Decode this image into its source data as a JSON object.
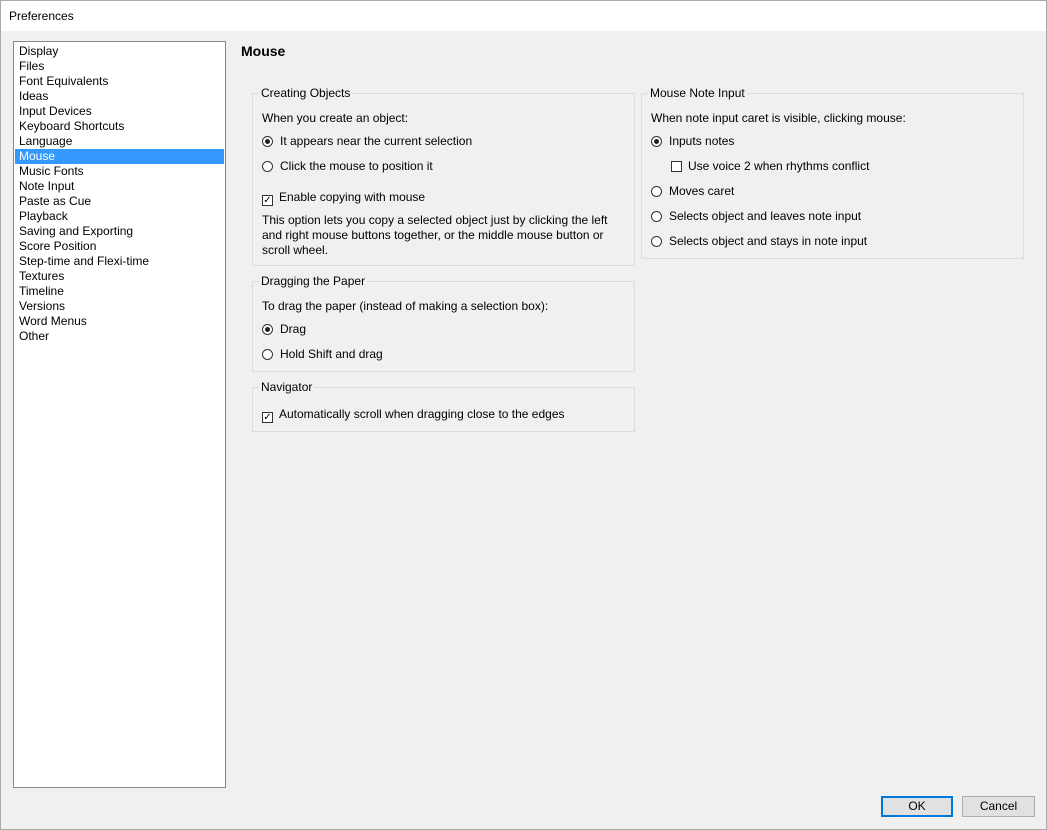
{
  "window": {
    "title": "Preferences"
  },
  "sidebar": {
    "items": [
      "Display",
      "Files",
      "Font Equivalents",
      "Ideas",
      "Input Devices",
      "Keyboard Shortcuts",
      "Language",
      "Mouse",
      "Music Fonts",
      "Note Input",
      "Paste as Cue",
      "Playback",
      "Saving and Exporting",
      "Score Position",
      "Step-time and Flexi-time",
      "Textures",
      "Timeline",
      "Versions",
      "Word Menus",
      "Other"
    ],
    "selected": "Mouse"
  },
  "page": {
    "title": "Mouse"
  },
  "creating_objects": {
    "legend": "Creating Objects",
    "prompt": "When you create an object:",
    "option_near": "It appears near the current selection",
    "option_click": "Click the mouse to position it",
    "enable_copy": "Enable copying with mouse",
    "description": "This option lets you copy a selected object just by clicking the left and right mouse buttons together, or the middle mouse button or scroll wheel."
  },
  "dragging_paper": {
    "legend": "Dragging the Paper",
    "prompt": "To drag the paper (instead of making a selection box):",
    "option_drag": "Drag",
    "option_shift": "Hold Shift and drag"
  },
  "navigator": {
    "legend": "Navigator",
    "auto_scroll": "Automatically scroll when dragging close to the edges"
  },
  "mouse_note_input": {
    "legend": "Mouse Note Input",
    "prompt": "When note input caret is visible, clicking mouse:",
    "option_inputs": "Inputs notes",
    "voice2": "Use voice 2 when rhythms conflict",
    "option_moves": "Moves caret",
    "option_select_leave": "Selects object and leaves note input",
    "option_select_stay": "Selects object and stays in note input"
  },
  "buttons": {
    "ok": "OK",
    "cancel": "Cancel"
  }
}
